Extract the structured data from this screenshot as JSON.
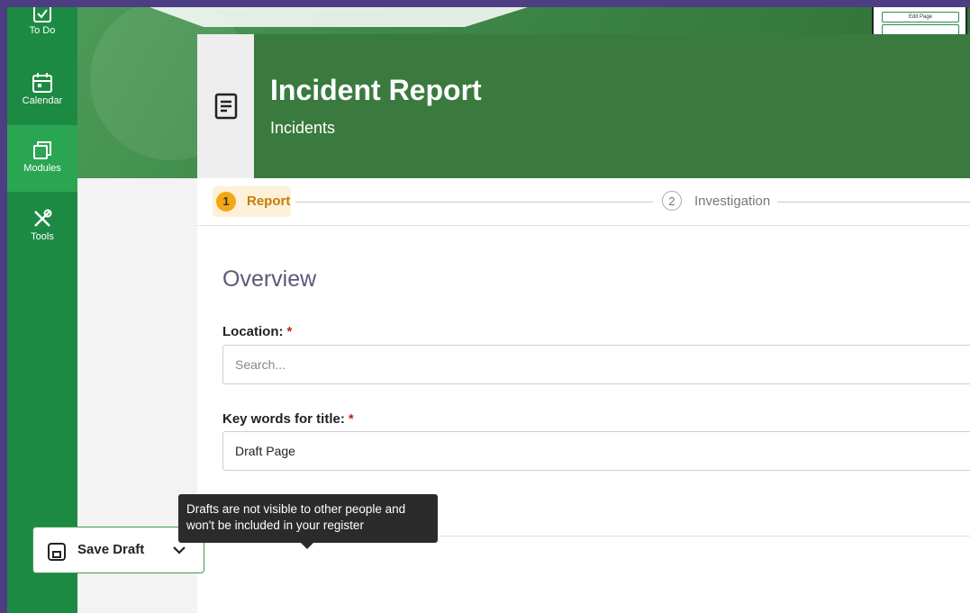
{
  "sidebar": {
    "items": [
      {
        "label": "To Do",
        "icon": "checkbox-icon"
      },
      {
        "label": "Calendar",
        "icon": "calendar-icon"
      },
      {
        "label": "Modules",
        "icon": "modules-icon",
        "active": true
      },
      {
        "label": "Tools",
        "icon": "tools-icon"
      }
    ]
  },
  "thumbnail": {
    "button1": "Edit Page"
  },
  "card": {
    "title": "Incident Report",
    "subtitle": "Incidents",
    "icon": "document-icon"
  },
  "stepper": {
    "steps": [
      {
        "number": "1",
        "label": "Report",
        "active": true
      },
      {
        "number": "2",
        "label": "Investigation",
        "active": false
      }
    ]
  },
  "form": {
    "section_title": "Overview",
    "location": {
      "label": "Location:",
      "required": "*",
      "placeholder": "Search..."
    },
    "title_keywords": {
      "label": "Key words for title:",
      "required": "*",
      "value": "Draft Page"
    }
  },
  "actions": {
    "save_draft_label": "Save Draft",
    "tooltip_line1": "Drafts are not visible to other people and",
    "tooltip_line2": "won't be included in your register"
  },
  "colors": {
    "sidebar": "#1d8a43",
    "header": "#3a7a3f",
    "step_active": "#f3a712",
    "required": "#c0241c",
    "frame": "#4d3d82"
  }
}
